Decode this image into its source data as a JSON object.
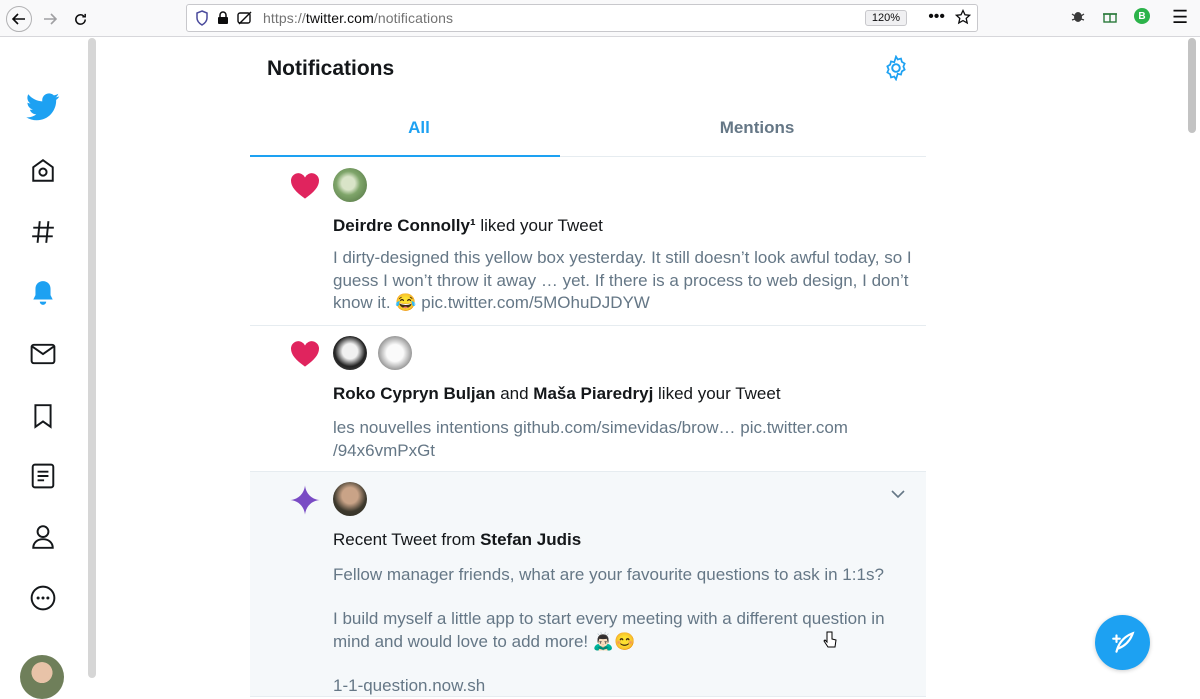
{
  "browser": {
    "url_prefix": "https://",
    "url_host": "twitter.com",
    "url_path": "/notifications",
    "zoom": "120%",
    "profile_badge": "B"
  },
  "page": {
    "title": "Notifications",
    "tabs": [
      {
        "label": "All",
        "active": true
      },
      {
        "label": "Mentions",
        "active": false
      }
    ]
  },
  "notifications": [
    {
      "type": "like",
      "icon": "heart-icon",
      "actors": [
        "Deirdre Connolly¹"
      ],
      "action": " liked your Tweet",
      "body": "I dirty-designed this yellow box yesterday. It still doesn’t look awful today, so I guess I won’t throw it away … yet. If there is a process to web design, I don’t know it. 😂 pic.twitter.com/5MOhuDJDYW"
    },
    {
      "type": "like",
      "icon": "heart-icon",
      "actors": [
        "Roko Cypryn Buljan",
        "Maša Piaredryj"
      ],
      "joiner": " and ",
      "action": " liked your Tweet",
      "body": "les nouvelles intentions github.com/simevidas/brow… pic.twitter.com /94x6vmPxGt"
    },
    {
      "type": "recent",
      "icon": "sparkle-icon",
      "prefix": "Recent Tweet from ",
      "actors": [
        "Stefan Judis"
      ],
      "body_lines": [
        "Fellow manager friends, what are your favourite questions to ask in 1:1s?",
        "I build myself a little app to start every meeting with a different question in mind and would love to add more! 🙇🏻‍♂️😊",
        "1-1-question.now.sh"
      ]
    }
  ],
  "colors": {
    "accent": "#1da1f2",
    "like": "#e0245e",
    "sparkle": "#794bc4",
    "muted": "#657786"
  }
}
